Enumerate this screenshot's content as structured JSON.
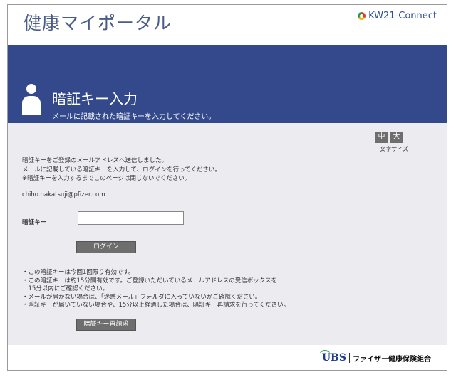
{
  "header": {
    "site_title": "健康マイポータル",
    "brand": "KW21-Connect"
  },
  "banner": {
    "title": "暗証キー入力",
    "subtitle": "メールに記載された暗証キーを入力してください。"
  },
  "font_size": {
    "medium": "中",
    "large": "大",
    "label": "文字サイズ"
  },
  "message": {
    "line1": "暗証キーをご登録のメールアドレスへ送信しました。",
    "line2": "メールに記載している暗証キーを入力して、ログインを行ってください。",
    "line3": "※暗証キーを入力するまでこのページは閉じないでください。"
  },
  "email": "chiho.nakatsuji@pfizer.com",
  "form": {
    "code_label": "暗証キー",
    "code_value": "",
    "login_button": "ログイン"
  },
  "notes": [
    "・この暗証キーは今回1回限り有効です。",
    "・この暗証キーは約15分間有効です。ご登録いただいているメールアドレスの受信ボックスを",
    "　15分以内にご確認ください。",
    "・メールが届かない場合は、「迷惑メール」フォルダに入っていないかご確認ください。",
    "・暗証キーが届いていない場合や、15分以上経過した場合は、暗証キー再請求を行ってください。"
  ],
  "resend_button": "暗証キー再請求",
  "footer": {
    "logo_text": "UBS",
    "org_name": "ファイザー健康保険組合"
  },
  "colors": {
    "banner": "#33498c",
    "title": "#4a5d8a",
    "main_bg": "#ebebf0",
    "button": "#6e6e6e"
  }
}
